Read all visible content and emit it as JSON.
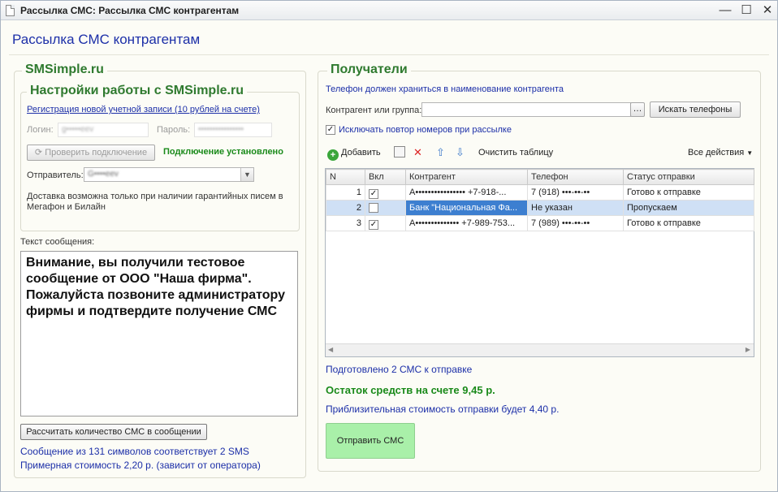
{
  "window": {
    "title": "Рассылка СМС: Рассылка СМС контрагентам"
  },
  "header": {
    "title": "Рассылка СМС контрагентам"
  },
  "left": {
    "group_title": "SMSimple.ru",
    "settings": {
      "title": "Настройки работы с SMSimple.ru",
      "register_link": "Регистрация новой учетной записи (10 рублей на счете)",
      "login_label": "Логин:",
      "login_value": "g•••••eev",
      "password_label": "Пароль:",
      "password_value": "••••••••••••••••",
      "check_button": "Проверить подключение",
      "connection_status": "Подключение установлено",
      "sender_label": "Отправитель:",
      "sender_value": "G••••eev",
      "delivery_note": "Доставка возможна только при наличии гарантийных писем в Мегафон и Билайн"
    },
    "message_label": "Текст сообщения:",
    "message_text": "Внимание, вы получили тестовое сообщение от ООО \"Наша фирма\". Пожалуйста позвоните администратору фирмы и подтвердите получение СМС",
    "calc_button": "Рассчитать количество СМС в сообщении",
    "sms_info": "Сообщение из 131 символов соответствует 2 SMS",
    "cost_info": "Примерная стоимость 2,20 р. (зависит от оператора)"
  },
  "right": {
    "group_title": "Получатели",
    "phone_hint": "Телефон должен храниться в наименование контрагента",
    "contractor_label": "Контрагент или группа:",
    "contractor_value": "",
    "search_button": "Искать телефоны",
    "exclude_dup_label": "Исключать повтор номеров при рассылке",
    "exclude_dup_checked": true,
    "toolbar": {
      "add": "Добавить",
      "clear": "Очистить таблицу",
      "all_actions": "Все действия"
    },
    "table": {
      "columns": [
        "N",
        "Вкл",
        "Контрагент",
        "Телефон",
        "Статус отправки"
      ],
      "rows": [
        {
          "n": "1",
          "checked": true,
          "contractor": "А•••••••••••••••• +7-918-...",
          "phone": "7 (918) •••-••-••",
          "status": "Готово к отправке"
        },
        {
          "n": "2",
          "checked": false,
          "contractor": "Банк \"Национальная Фа...",
          "phone": "Не указан",
          "status": "Пропускаем"
        },
        {
          "n": "3",
          "checked": true,
          "contractor": "А•••••••••••••• +7-989-753...",
          "phone": "7 (989) •••-••-••",
          "status": "Готово к отправке"
        }
      ]
    },
    "prepared": "Подготовлено 2 СМС к отправке",
    "balance": "Остаток средств на счете 9,45 р.",
    "approx_cost": "Приблизительная стоимость отправки будет 4,40 р.",
    "send_button": "Отправить СМС"
  }
}
